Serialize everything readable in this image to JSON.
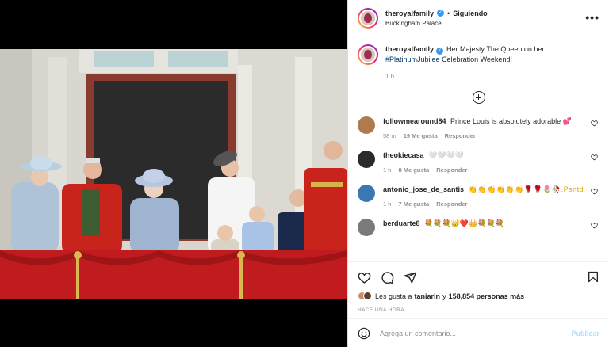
{
  "post": {
    "username": "theroyalfamily",
    "follow_state": "Siguiendo",
    "separator": "•",
    "location": "Buckingham Palace",
    "more_label": "•••"
  },
  "caption": {
    "username": "theroyalfamily",
    "text": "Her Majesty The Queen on her",
    "hashtag": "#PlatinumJubilee",
    "text_after": "Celebration Weekend!",
    "time": "1 h"
  },
  "comments": [
    {
      "username": "followmearound84",
      "text": "Prince Louis is absolutely adorable 💕",
      "time": "58 m",
      "likes": "19 Me gusta",
      "reply": "Responder",
      "avatar_color": "#b07a4f"
    },
    {
      "username": "theokiecasa",
      "text": "🤍🤍🤍🤍",
      "time": "1 h",
      "likes": "8 Me gusta",
      "reply": "Responder",
      "avatar_color": "#2b2b2b"
    },
    {
      "username": "antonio_jose_de_santis",
      "text": "👏👏👏👏👏👏🌹🌹🌷🥀.Psntd",
      "time": "1 h",
      "likes": "7 Me gusta",
      "reply": "Responder",
      "avatar_color": "#3a78b5"
    },
    {
      "username": "berduarte8",
      "text": "💐💐💐👑❤️👑💐💐💐",
      "time": "",
      "likes": "",
      "reply": "",
      "avatar_color": "#7a7a7a"
    }
  ],
  "actions": {
    "like_icon": "heart-icon",
    "comment_icon": "comment-icon",
    "share_icon": "share-icon",
    "save_icon": "bookmark-icon"
  },
  "likes": {
    "prefix": "Les gusta a",
    "user": "taniarin",
    "joiner": "y",
    "count": "158,854 personas más"
  },
  "posted_ago": "HACE UNA HORA",
  "add_comment": {
    "placeholder": "Agrega un comentario...",
    "publish_label": "Publicar",
    "emoji_icon": "emoji-icon"
  },
  "colors": {
    "verified": "#3897f0",
    "hashtag": "#00376b",
    "publish_disabled": "#b2dffc",
    "muted": "#8e8e8e"
  }
}
